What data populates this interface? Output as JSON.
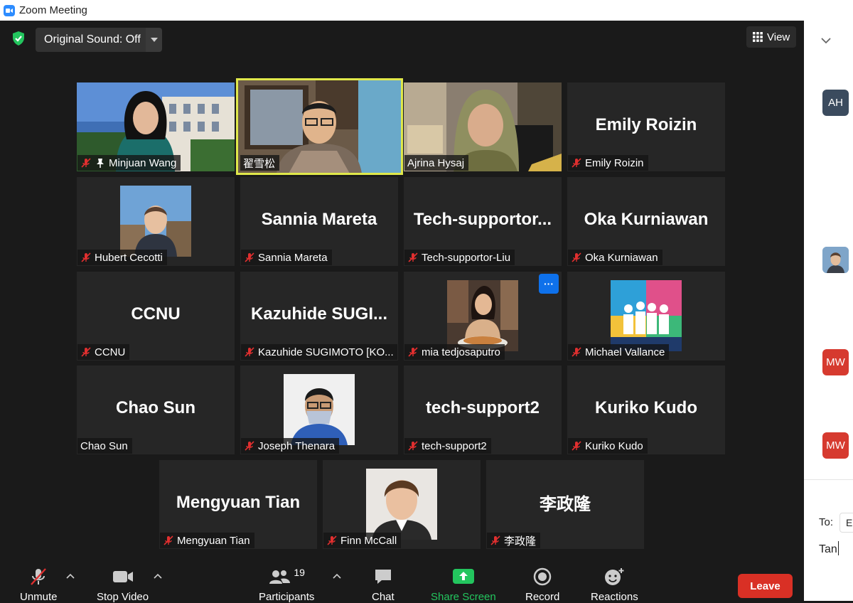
{
  "window": {
    "title": "Zoom Meeting"
  },
  "topbar": {
    "sound_label": "Original Sound: Off",
    "view_label": "View"
  },
  "participants": [
    {
      "name": "Minjuan Wang",
      "display": "video",
      "muted": true,
      "pinned": true
    },
    {
      "name": "翟雪松",
      "display": "video",
      "muted": false,
      "active_speaker": true
    },
    {
      "name": "Ajrina Hysaj",
      "display": "video",
      "muted": false
    },
    {
      "name": "Emily Roizin",
      "big_name": "Emily Roizin",
      "display": "name",
      "muted": true
    },
    {
      "name": "Hubert Cecotti",
      "display": "photo",
      "muted": true
    },
    {
      "name": "Sannia Mareta",
      "big_name": "Sannia Mareta",
      "display": "name",
      "muted": true
    },
    {
      "name": "Tech-supportor-Liu",
      "big_name": "Tech-supportor...",
      "display": "name",
      "muted": true
    },
    {
      "name": "Oka Kurniawan",
      "big_name": "Oka Kurniawan",
      "display": "name",
      "muted": true
    },
    {
      "name": "CCNU",
      "big_name": "CCNU",
      "display": "name",
      "muted": true
    },
    {
      "name": "Kazuhide SUGIMOTO [KO...",
      "big_name": "Kazuhide  SUGI...",
      "display": "name",
      "muted": true
    },
    {
      "name": "mia tedjosaputro",
      "display": "photo",
      "muted": true,
      "hover_menu": "···"
    },
    {
      "name": "Michael Vallance",
      "display": "photo",
      "muted": true
    },
    {
      "name": "Chao Sun",
      "big_name": "Chao Sun",
      "display": "name",
      "muted": false
    },
    {
      "name": "Joseph Thenara",
      "display": "photo",
      "muted": true
    },
    {
      "name": "tech-support2",
      "big_name": "tech-support2",
      "display": "name",
      "muted": true
    },
    {
      "name": "Kuriko Kudo",
      "big_name": "Kuriko Kudo",
      "display": "name",
      "muted": true
    },
    {
      "name": "Mengyuan Tian",
      "big_name": "Mengyuan Tian",
      "display": "name",
      "muted": true
    },
    {
      "name": "Finn McCall",
      "display": "photo",
      "muted": true
    },
    {
      "name": "李政隆",
      "big_name": "李政隆",
      "display": "name",
      "muted": true
    }
  ],
  "toolbar": {
    "unmute": "Unmute",
    "stop_video": "Stop Video",
    "participants": "Participants",
    "participants_count": "19",
    "chat": "Chat",
    "share_screen": "Share Screen",
    "record": "Record",
    "reactions": "Reactions",
    "leave": "Leave"
  },
  "chat_panel": {
    "avatars": [
      "AH",
      "MW",
      "MW"
    ],
    "to_label": "To:",
    "to_value": "E",
    "typed": "Tan"
  },
  "colors": {
    "accent_blue": "#2d8cff",
    "leave_red": "#d93025",
    "share_green": "#23c55e",
    "speaker_border": "#e0e84a",
    "muted_red": "#e02f2f"
  }
}
